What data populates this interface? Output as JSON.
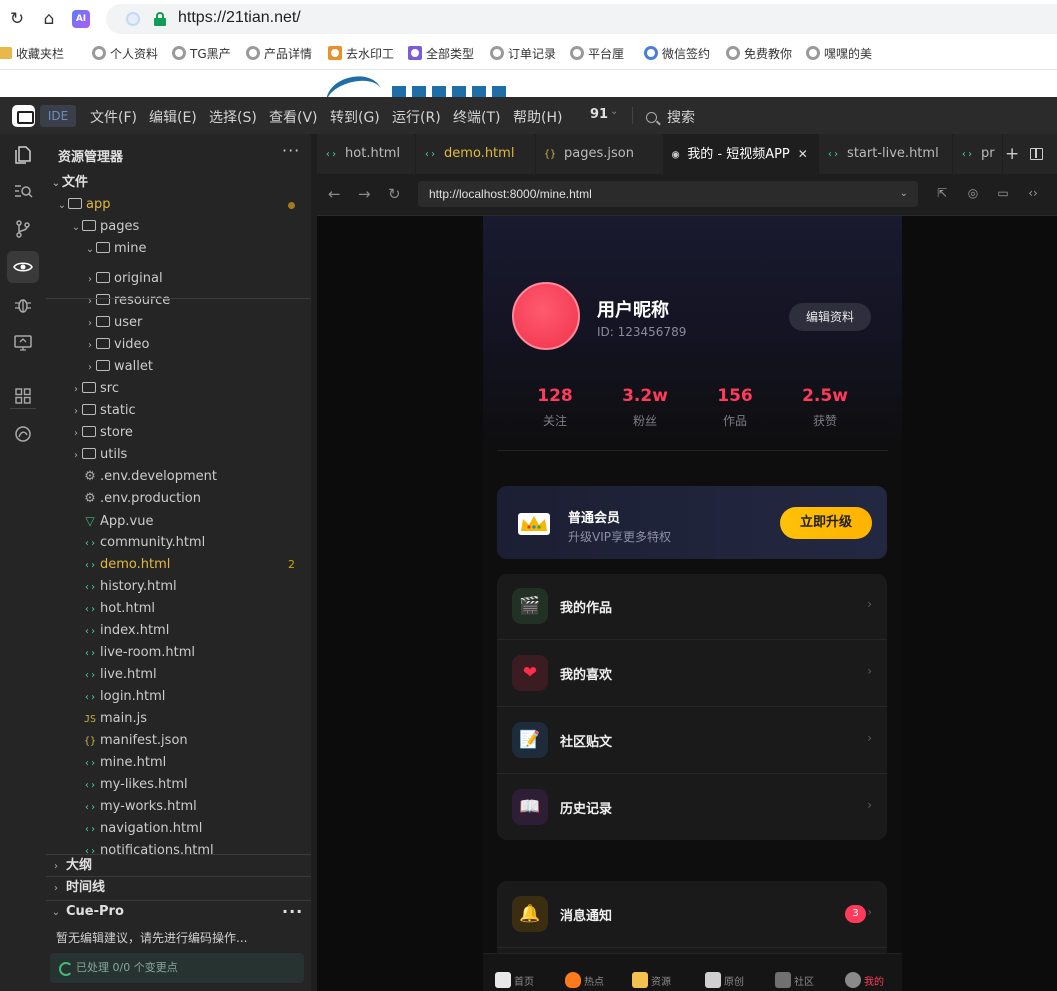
{
  "browser": {
    "url": "https://21tian.net/",
    "ai_badge": "AI",
    "bookmarks": [
      "收藏夹栏",
      "个人资料",
      "TG黑产",
      "产品详情",
      "去水印工",
      "全部类型",
      "订单记录",
      "平台厘",
      "微信签约",
      "免费教你",
      "嘿嘿的美"
    ]
  },
  "ide": {
    "tag": "IDE",
    "menu": [
      "文件(F)",
      "编辑(E)",
      "选择(S)",
      "查看(V)",
      "转到(G)",
      "运行(R)",
      "终端(T)",
      "帮助(H)"
    ],
    "workspace_number": "91",
    "search_label": "搜索",
    "explorer_title": "资源管理器",
    "tree": [
      {
        "label": "文件",
        "depth": 0,
        "kind": "section",
        "open": true
      },
      {
        "label": "app",
        "depth": 1,
        "kind": "folder",
        "open": true,
        "modified": true
      },
      {
        "label": "pages",
        "depth": 2,
        "kind": "folder",
        "open": true
      },
      {
        "label": "mine",
        "depth": 3,
        "kind": "folder",
        "open": true
      },
      {
        "label": "original",
        "depth": 3,
        "kind": "folder"
      },
      {
        "label": "resource",
        "depth": 3,
        "kind": "folder"
      },
      {
        "label": "user",
        "depth": 3,
        "kind": "folder"
      },
      {
        "label": "video",
        "depth": 3,
        "kind": "folder"
      },
      {
        "label": "wallet",
        "depth": 3,
        "kind": "folder"
      },
      {
        "label": "src",
        "depth": 2,
        "kind": "folder"
      },
      {
        "label": "static",
        "depth": 2,
        "kind": "folder"
      },
      {
        "label": "store",
        "depth": 2,
        "kind": "folder"
      },
      {
        "label": "utils",
        "depth": 2,
        "kind": "folder"
      },
      {
        "label": ".env.development",
        "depth": 2,
        "kind": "gear"
      },
      {
        "label": ".env.production",
        "depth": 2,
        "kind": "gear"
      },
      {
        "label": "App.vue",
        "depth": 2,
        "kind": "vue"
      },
      {
        "label": "community.html",
        "depth": 2,
        "kind": "html"
      },
      {
        "label": "demo.html",
        "depth": 2,
        "kind": "html",
        "modified": true,
        "badge": "2"
      },
      {
        "label": "history.html",
        "depth": 2,
        "kind": "html"
      },
      {
        "label": "hot.html",
        "depth": 2,
        "kind": "html"
      },
      {
        "label": "index.html",
        "depth": 2,
        "kind": "html"
      },
      {
        "label": "live-room.html",
        "depth": 2,
        "kind": "html"
      },
      {
        "label": "live.html",
        "depth": 2,
        "kind": "html"
      },
      {
        "label": "login.html",
        "depth": 2,
        "kind": "html"
      },
      {
        "label": "main.js",
        "depth": 2,
        "kind": "js"
      },
      {
        "label": "manifest.json",
        "depth": 2,
        "kind": "json"
      },
      {
        "label": "mine.html",
        "depth": 2,
        "kind": "html"
      },
      {
        "label": "my-likes.html",
        "depth": 2,
        "kind": "html"
      },
      {
        "label": "my-works.html",
        "depth": 2,
        "kind": "html"
      },
      {
        "label": "navigation.html",
        "depth": 2,
        "kind": "html"
      },
      {
        "label": "notifications.html",
        "depth": 2,
        "kind": "html"
      }
    ],
    "sections": {
      "outline": "大纲",
      "timeline": "时间线",
      "cue": "Cue-Pro"
    },
    "cue_message": "暂无编辑建议，请先进行编码操作...",
    "cue_status": "已处理 0/0 个变更点",
    "tabs": [
      {
        "label": "hot.html",
        "icon": "html"
      },
      {
        "label": "demo.html",
        "icon": "html",
        "modified": true
      },
      {
        "label": "pages.json",
        "icon": "json"
      },
      {
        "label": "我的 - 短视频APP",
        "icon": "eye",
        "active": true,
        "closable": true
      },
      {
        "label": "start-live.html",
        "icon": "html"
      },
      {
        "label": "pr",
        "icon": "html"
      }
    ],
    "preview_url": "http://localhost:8000/mine.html"
  },
  "app": {
    "nickname": "用户昵称",
    "user_id": "ID: 123456789",
    "edit_profile": "编辑资料",
    "stats": [
      {
        "value": "128",
        "label": "关注"
      },
      {
        "value": "3.2w",
        "label": "粉丝"
      },
      {
        "value": "156",
        "label": "作品"
      },
      {
        "value": "2.5w",
        "label": "获赞"
      }
    ],
    "vip": {
      "title": "普通会员",
      "subtitle": "升级VIP享更多特权",
      "button": "立即升级"
    },
    "menu": [
      {
        "label": "我的作品",
        "icon": "clapperboard-icon",
        "glyph": "🎬",
        "bg": "#213124"
      },
      {
        "label": "我的喜欢",
        "icon": "heart-icon",
        "glyph": "❤",
        "bg": "#3a1c22"
      },
      {
        "label": "社区贴文",
        "icon": "memo-icon",
        "glyph": "📝",
        "bg": "#1d2b3a"
      },
      {
        "label": "历史记录",
        "icon": "book-icon",
        "glyph": "📖",
        "bg": "#2d1d35"
      }
    ],
    "notify": {
      "label": "消息通知",
      "icon": "bell-icon",
      "glyph": "🔔",
      "bg": "#3a2d12",
      "badge": "3"
    },
    "bottom_nav": [
      "首页",
      "热点",
      "资源",
      "原创",
      "社区",
      "我的"
    ],
    "accent": "#ff3b5c",
    "vip_gold": "#ffc107"
  }
}
